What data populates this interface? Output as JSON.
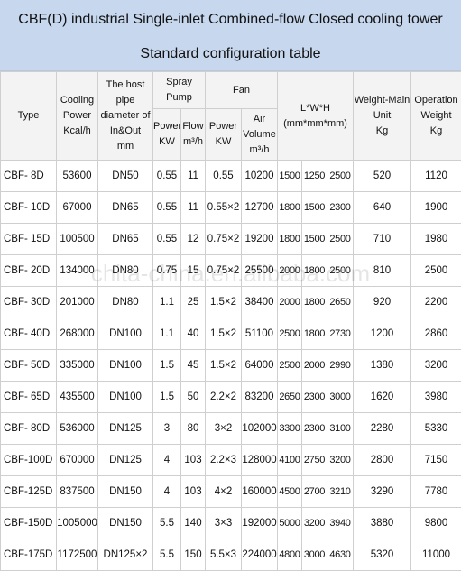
{
  "title": {
    "line1": "CBF(D) industrial Single-inlet Combined-flow Closed cooling tower",
    "line2": "Standard configuration table"
  },
  "headers": {
    "type": "Type",
    "cooling_power": [
      "Cooling",
      "Power",
      "Kcal/h"
    ],
    "host_pipe": [
      "The host",
      "pipe",
      "diameter of",
      "In&Out",
      "mm"
    ],
    "spray_pump": [
      "Spray",
      "Pump"
    ],
    "spray_power": [
      "Power",
      "KW"
    ],
    "spray_flow": [
      "Flow",
      "m³/h"
    ],
    "fan": "Fan",
    "fan_power": [
      "Power",
      "KW"
    ],
    "fan_air_volume": [
      "Air",
      "Volume",
      "m³/h"
    ],
    "lwh": [
      "L*W*H",
      "(mm*mm*mm)"
    ],
    "weight_main": [
      "Weight-Main",
      "Unit",
      "Kg"
    ],
    "operation_weight": [
      "Operation",
      "Weight",
      "Kg"
    ]
  },
  "rows": [
    {
      "type": "CBF- 8D",
      "cooling": "53600",
      "pipe": "DN50",
      "pump_kw": "0.55",
      "flow": "11",
      "fan_kw": "0.55",
      "air": "10200",
      "l": "1500",
      "w": "1250",
      "h": "2500",
      "weight": "520",
      "op_weight": "1120"
    },
    {
      "type": "CBF- 10D",
      "cooling": "67000",
      "pipe": "DN65",
      "pump_kw": "0.55",
      "flow": "11",
      "fan_kw": "0.55×2",
      "air": "12700",
      "l": "1800",
      "w": "1500",
      "h": "2300",
      "weight": "640",
      "op_weight": "1900"
    },
    {
      "type": "CBF- 15D",
      "cooling": "100500",
      "pipe": "DN65",
      "pump_kw": "0.55",
      "flow": "12",
      "fan_kw": "0.75×2",
      "air": "19200",
      "l": "1800",
      "w": "1500",
      "h": "2500",
      "weight": "710",
      "op_weight": "1980"
    },
    {
      "type": "CBF- 20D",
      "cooling": "134000",
      "pipe": "DN80",
      "pump_kw": "0.75",
      "flow": "15",
      "fan_kw": "0.75×2",
      "air": "25500",
      "l": "2000",
      "w": "1800",
      "h": "2500",
      "weight": "810",
      "op_weight": "2500"
    },
    {
      "type": "CBF- 30D",
      "cooling": "201000",
      "pipe": "DN80",
      "pump_kw": "1.1",
      "flow": "25",
      "fan_kw": "1.5×2",
      "air": "38400",
      "l": "2000",
      "w": "1800",
      "h": "2650",
      "weight": "920",
      "op_weight": "2200"
    },
    {
      "type": "CBF- 40D",
      "cooling": "268000",
      "pipe": "DN100",
      "pump_kw": "1.1",
      "flow": "40",
      "fan_kw": "1.5×2",
      "air": "51100",
      "l": "2500",
      "w": "1800",
      "h": "2730",
      "weight": "1200",
      "op_weight": "2860"
    },
    {
      "type": "CBF- 50D",
      "cooling": "335000",
      "pipe": "DN100",
      "pump_kw": "1.5",
      "flow": "45",
      "fan_kw": "1.5×2",
      "air": "64000",
      "l": "2500",
      "w": "2000",
      "h": "2990",
      "weight": "1380",
      "op_weight": "3200"
    },
    {
      "type": "CBF- 65D",
      "cooling": "435500",
      "pipe": "DN100",
      "pump_kw": "1.5",
      "flow": "50",
      "fan_kw": "2.2×2",
      "air": "83200",
      "l": "2650",
      "w": "2300",
      "h": "3000",
      "weight": "1620",
      "op_weight": "3980"
    },
    {
      "type": "CBF- 80D",
      "cooling": "536000",
      "pipe": "DN125",
      "pump_kw": "3",
      "flow": "80",
      "fan_kw": "3×2",
      "air": "102000",
      "l": "3300",
      "w": "2300",
      "h": "3100",
      "weight": "2280",
      "op_weight": "5330"
    },
    {
      "type": "CBF-100D",
      "cooling": "670000",
      "pipe": "DN125",
      "pump_kw": "4",
      "flow": "103",
      "fan_kw": "2.2×3",
      "air": "128000",
      "l": "4100",
      "w": "2750",
      "h": "3200",
      "weight": "2800",
      "op_weight": "7150"
    },
    {
      "type": "CBF-125D",
      "cooling": "837500",
      "pipe": "DN150",
      "pump_kw": "4",
      "flow": "103",
      "fan_kw": "4×2",
      "air": "160000",
      "l": "4500",
      "w": "2700",
      "h": "3210",
      "weight": "3290",
      "op_weight": "7780"
    },
    {
      "type": "CBF-150D",
      "cooling": "1005000",
      "pipe": "DN150",
      "pump_kw": "5.5",
      "flow": "140",
      "fan_kw": "3×3",
      "air": "192000",
      "l": "5000",
      "w": "3200",
      "h": "3940",
      "weight": "3880",
      "op_weight": "9800"
    },
    {
      "type": "CBF-175D",
      "cooling": "1172500",
      "pipe": "DN125×2",
      "pump_kw": "5.5",
      "flow": "150",
      "fan_kw": "5.5×3",
      "air": "224000",
      "l": "4800",
      "w": "3000",
      "h": "4630",
      "weight": "5320",
      "op_weight": "11000"
    }
  ],
  "watermark": "chita-china.en.alibaba.com",
  "colors": {
    "title_band": "#c6d7ee",
    "grid": "#cfcfcf"
  }
}
